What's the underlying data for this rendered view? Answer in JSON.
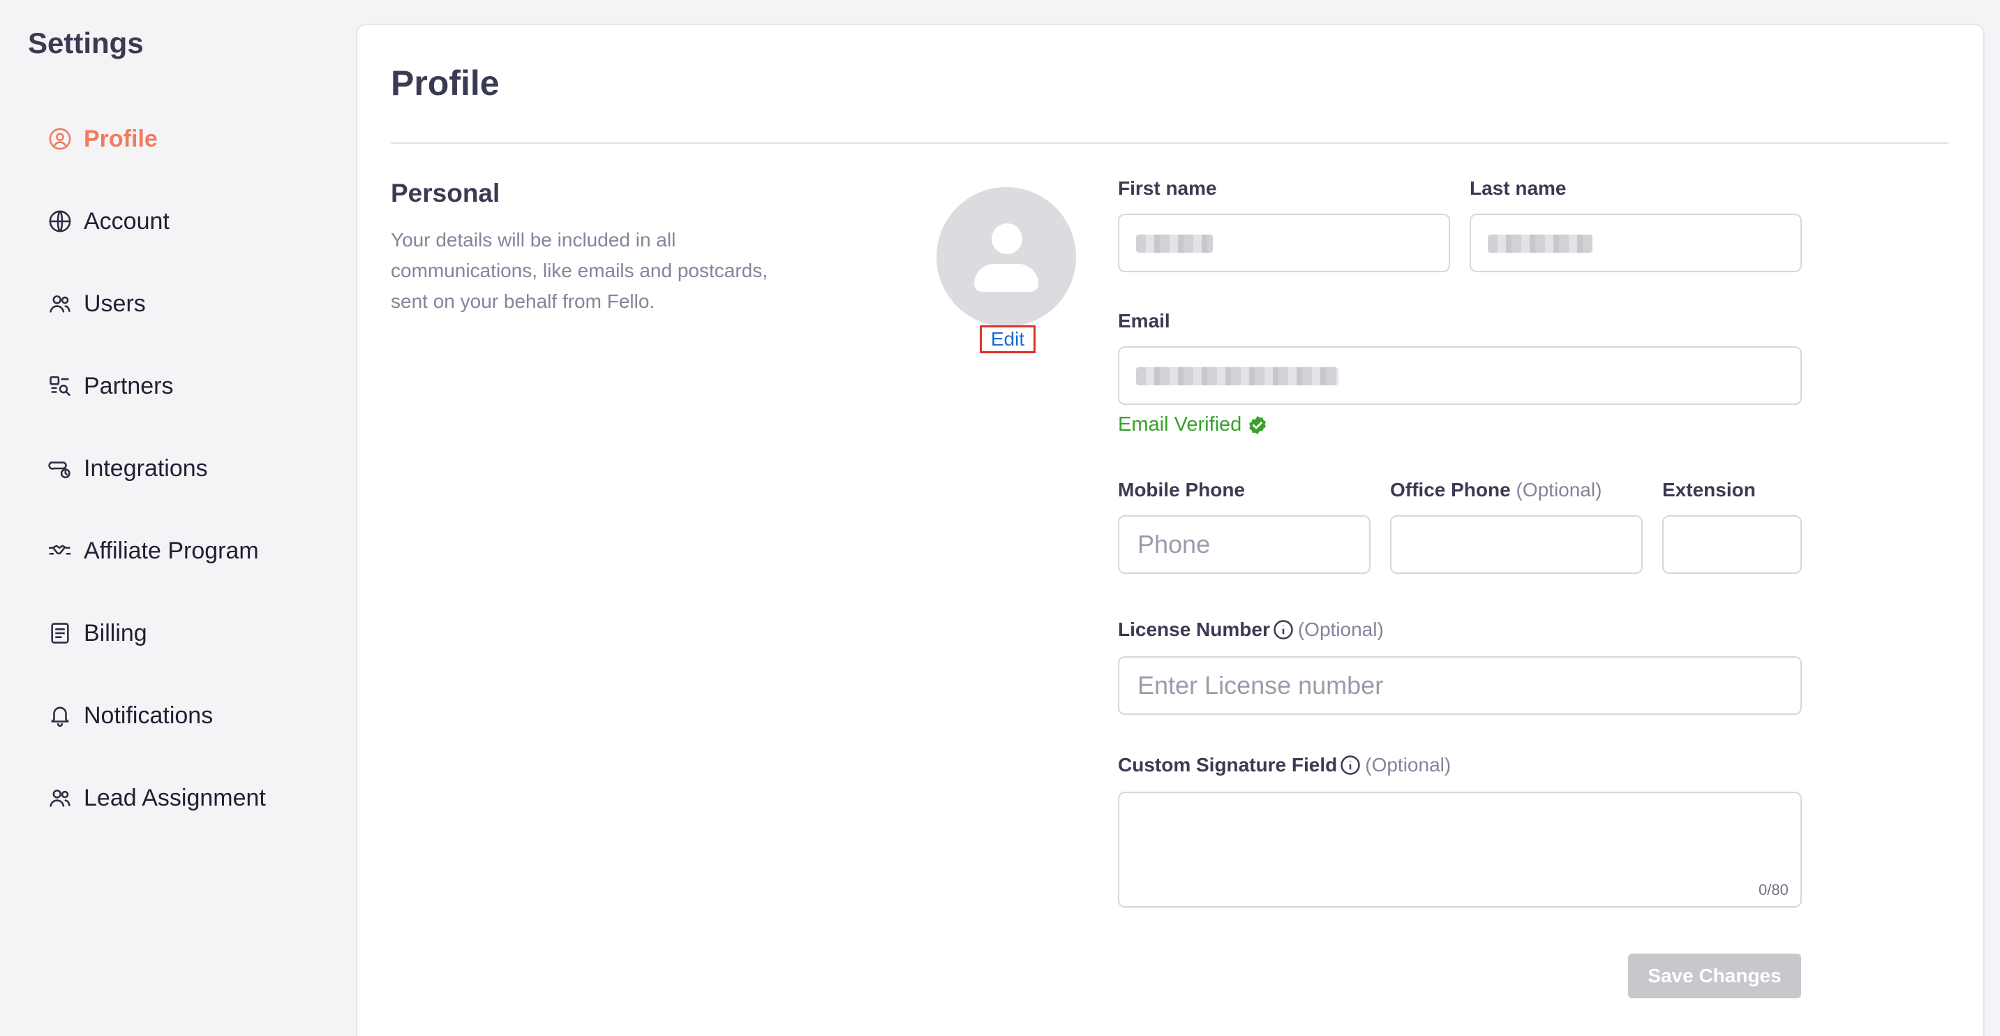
{
  "sidebar": {
    "title": "Settings",
    "items": [
      {
        "label": "Profile",
        "icon": "user-circle-icon",
        "active": true
      },
      {
        "label": "Account",
        "icon": "globe-icon"
      },
      {
        "label": "Users",
        "icon": "users-icon"
      },
      {
        "label": "Partners",
        "icon": "partners-icon"
      },
      {
        "label": "Integrations",
        "icon": "integrations-icon"
      },
      {
        "label": "Affiliate Program",
        "icon": "handshake-icon"
      },
      {
        "label": "Billing",
        "icon": "document-icon"
      },
      {
        "label": "Notifications",
        "icon": "bell-icon"
      },
      {
        "label": "Lead Assignment",
        "icon": "users-icon"
      }
    ]
  },
  "main": {
    "title": "Profile",
    "section": {
      "title": "Personal",
      "description": "Your details will be included in all communications, like emails and postcards, sent on your behalf from Fello."
    },
    "avatar": {
      "edit_label": "Edit"
    },
    "fields": {
      "first_name": {
        "label": "First name",
        "value": ""
      },
      "last_name": {
        "label": "Last name",
        "value": ""
      },
      "email": {
        "label": "Email",
        "value": "",
        "verified_text": "Email Verified"
      },
      "mobile_phone": {
        "label": "Mobile Phone",
        "placeholder": "Phone"
      },
      "office_phone": {
        "label": "Office Phone",
        "optional": "(Optional)",
        "placeholder": ""
      },
      "extension": {
        "label": "Extension",
        "placeholder": ""
      },
      "license_number": {
        "label": "License Number",
        "optional": "(Optional)",
        "placeholder": "Enter License number"
      },
      "custom_signature": {
        "label": "Custom Signature Field",
        "optional": "(Optional)",
        "counter": "0/80"
      }
    },
    "save_button": "Save Changes"
  },
  "colors": {
    "accent": "#f07b5e",
    "verified": "#3aa12c",
    "link": "#1f6cc6"
  }
}
